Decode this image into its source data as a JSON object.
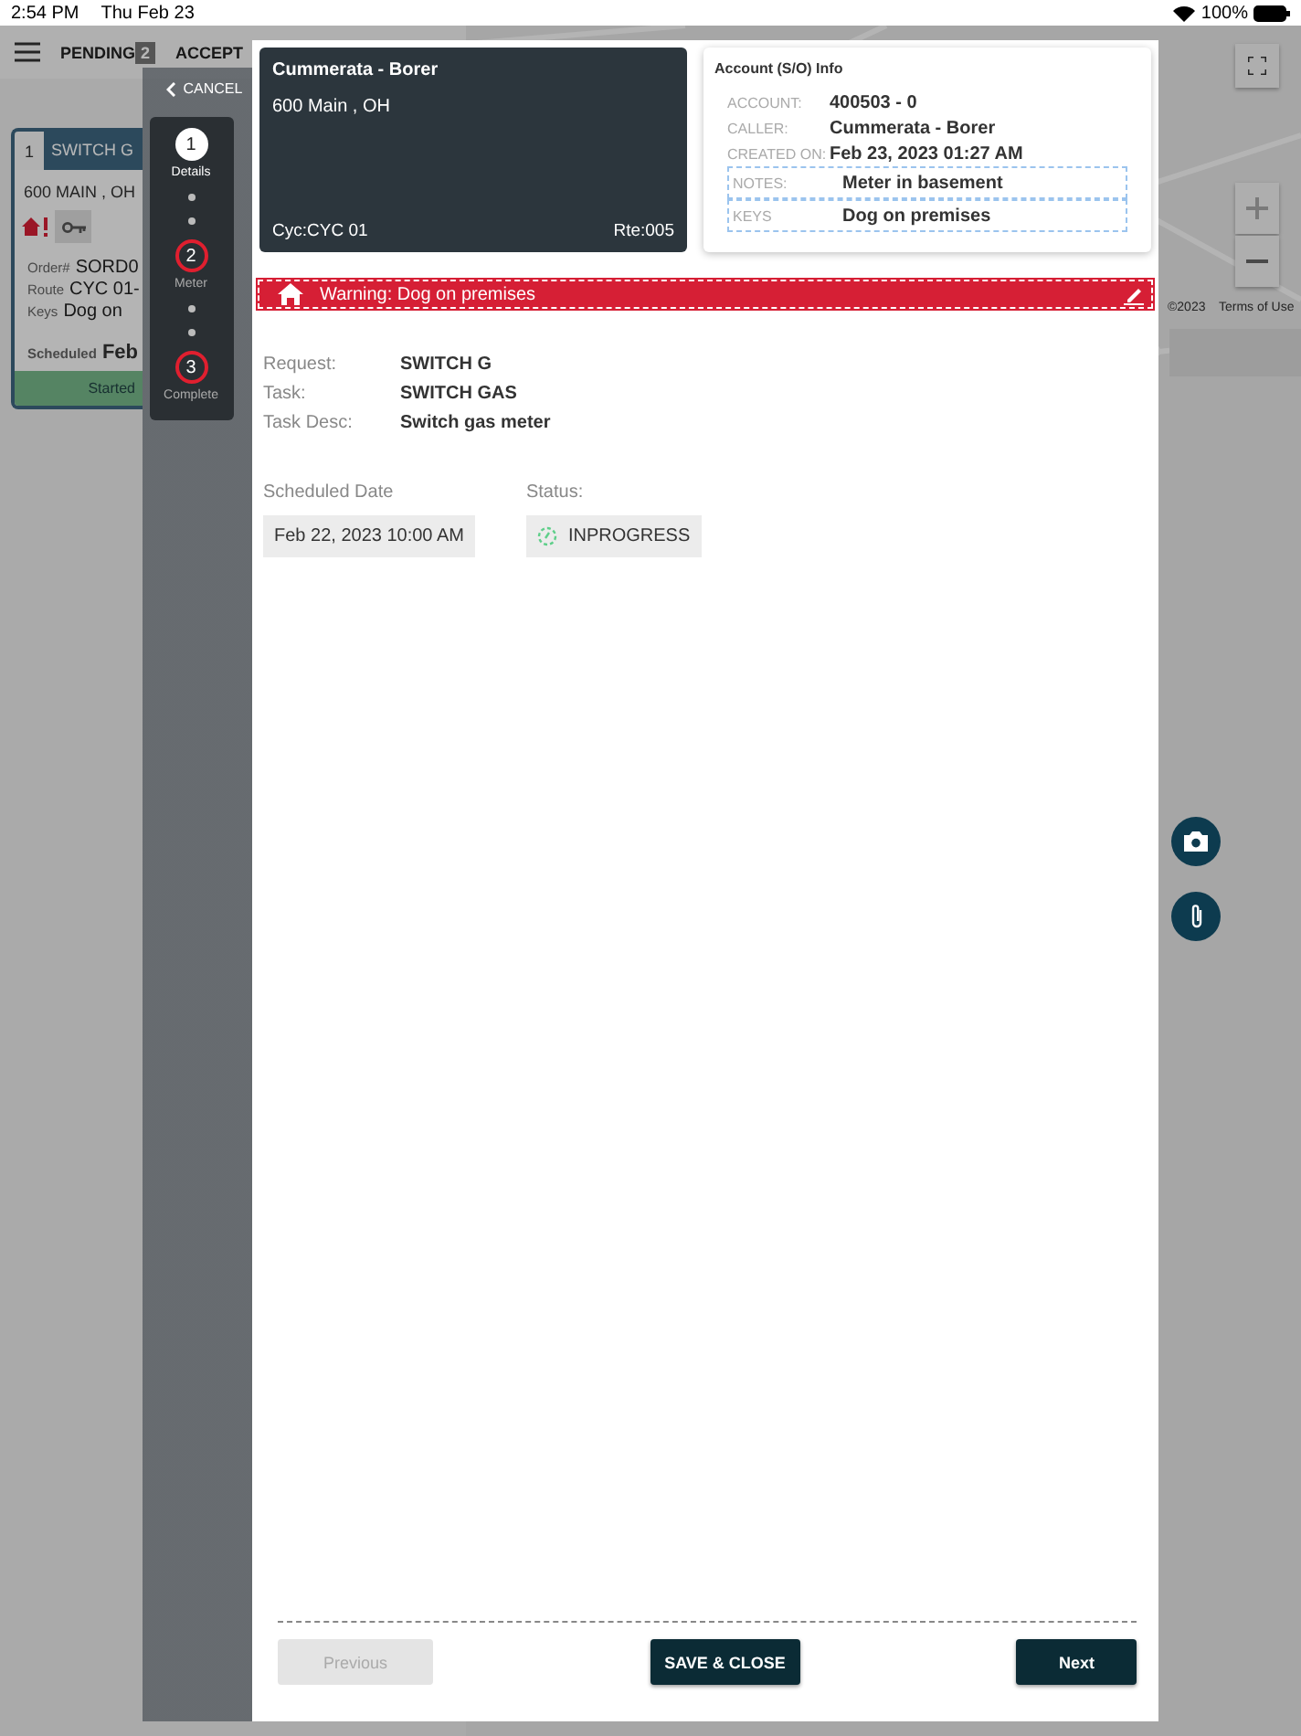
{
  "status_bar": {
    "time": "2:54 PM",
    "date": "Thu Feb 23",
    "battery": "100%"
  },
  "background": {
    "tabs": [
      {
        "label": "PENDING",
        "count": "2"
      },
      {
        "label": "ACCEPT"
      }
    ],
    "card": {
      "number": "1",
      "title": "SWITCH G",
      "address": "600 MAIN , OH",
      "fields": [
        {
          "label": "Order#",
          "value": "SORD0"
        },
        {
          "label": "Route",
          "value": "CYC 01-"
        },
        {
          "label": "Keys",
          "value": "Dog on"
        }
      ],
      "scheduled": {
        "label": "Scheduled",
        "value": "Feb"
      },
      "status": "Started"
    },
    "map": {
      "attribution": "©2023",
      "terms": "Terms of Use"
    }
  },
  "wizard": {
    "cancel": "CANCEL",
    "steps": [
      {
        "number": "1",
        "label": "Details",
        "selected": true
      },
      {
        "number": "2",
        "label": "Meter",
        "selected": false
      },
      {
        "number": "3",
        "label": "Complete",
        "selected": false
      }
    ]
  },
  "customer": {
    "name": "Cummerata - Borer",
    "address": "600 Main , OH",
    "cycle": "Cyc:CYC 01",
    "route": "Rte:005"
  },
  "account": {
    "title": "Account (S/O) Info",
    "rows": [
      {
        "kind": "plain",
        "label": "ACCOUNT:",
        "value": "400503 - 0"
      },
      {
        "kind": "plain",
        "label": "CALLER:",
        "value": "Cummerata - Borer"
      },
      {
        "kind": "plain",
        "label": "CREATED ON:",
        "value": "Feb 23, 2023 01:27 AM"
      },
      {
        "kind": "boxed",
        "label": "NOTES:",
        "value": "Meter in basement"
      },
      {
        "kind": "boxed",
        "label": "KEYS",
        "value": "Dog on premises"
      }
    ]
  },
  "warning": "Warning: Dog on premises",
  "details": [
    {
      "label": "Request:",
      "value": "SWITCH G"
    },
    {
      "label": "Task:",
      "value": "SWITCH GAS"
    },
    {
      "label": "Task Desc:",
      "value": "Switch gas meter"
    }
  ],
  "schedule": {
    "date_label": "Scheduled Date",
    "date": "Feb 22, 2023 10:00 AM",
    "status_label": "Status:",
    "status": "INPROGRESS"
  },
  "buttons": {
    "previous": {
      "label": "Previous",
      "disabled": true
    },
    "save": "SAVE & CLOSE",
    "next": "Next"
  }
}
